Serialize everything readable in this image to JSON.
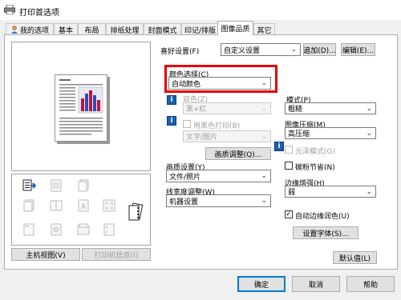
{
  "window": {
    "title": "打印首选项"
  },
  "tabs": [
    {
      "label": "我的选项"
    },
    {
      "label": "基本"
    },
    {
      "label": "布局"
    },
    {
      "label": "排纸处理"
    },
    {
      "label": "封面模式"
    },
    {
      "label": "印记/排版"
    },
    {
      "label": "图像品质"
    },
    {
      "label": "其它"
    }
  ],
  "favorite": {
    "label": "喜好设置(F)",
    "value": "自定义设置",
    "add_button": "追加(D)...",
    "edit_button": "编辑(E)..."
  },
  "color_select": {
    "label": "颜色选择(C)",
    "value": "自动颜色"
  },
  "dual_color": {
    "label": "双色(Z)",
    "value": "黑+红"
  },
  "black_print": {
    "label": "用黑色打印(B)",
    "value": "文字/图片"
  },
  "quality_adjust_button": "画质调整(Q)...",
  "quality_setting": {
    "label": "画质设置(Y)",
    "value": "文件/照片"
  },
  "line_width": {
    "label": "线宽度调整(W)",
    "value": "机器设置"
  },
  "pattern": {
    "label": "模式(P)",
    "value": "粗糙"
  },
  "compression": {
    "label": "图像压缩(M)",
    "value": "高压缩"
  },
  "glossy": {
    "label": "光泽模式(G)"
  },
  "toner_save": {
    "label": "碳粉节省(N)"
  },
  "edge": {
    "label": "边缘增强(H)",
    "value": "弱"
  },
  "auto_trapping": {
    "label": "自动边缘润色(U)",
    "checked": "✓"
  },
  "font_button": "设置字体(S)...",
  "default_button": "默认值(L)",
  "view_buttons": {
    "main": "主机视图(V)",
    "printer_info": "打印机信息(I)"
  },
  "dialog": {
    "ok": "确定",
    "cancel": "取消",
    "help": "帮助"
  },
  "info_glyph": "i",
  "chevron": "⌄",
  "colors": {
    "highlight": "#e30000",
    "accent": "#0078d7"
  }
}
